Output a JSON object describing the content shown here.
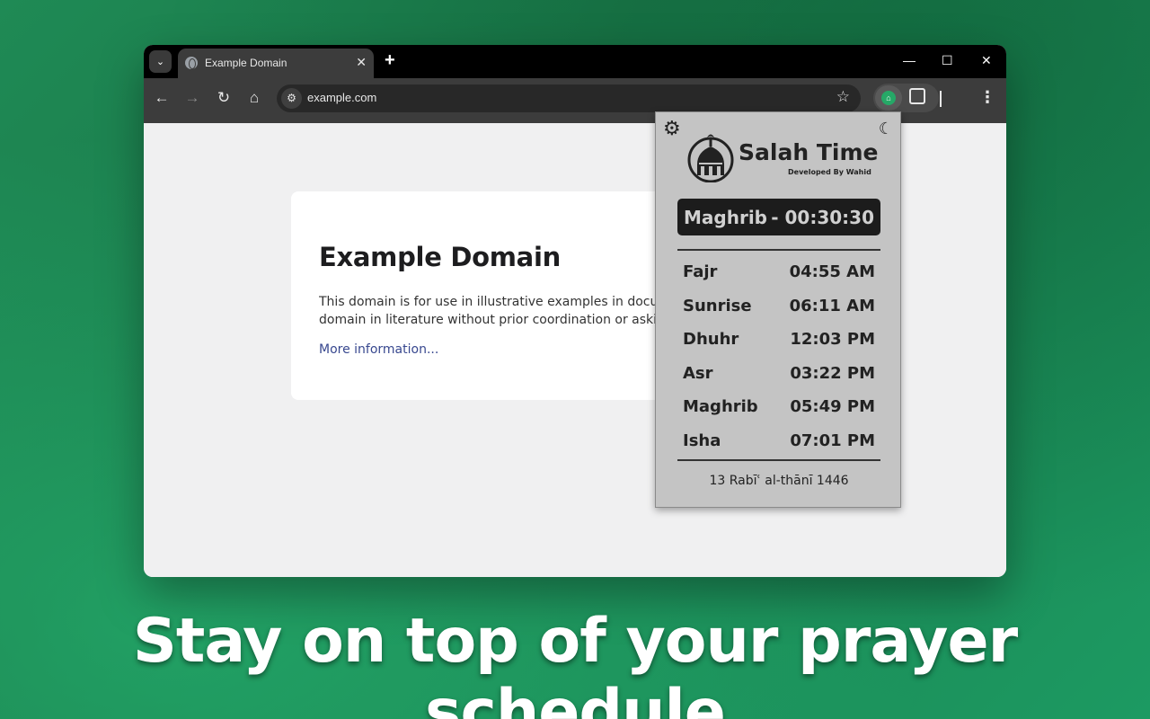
{
  "browser": {
    "tab": {
      "title": "Example Domain"
    },
    "toolbar": {
      "url": "example.com"
    }
  },
  "page": {
    "heading": "Example Domain",
    "paragraph_line1": "This domain is for use in illustrative examples in documents. You may use this",
    "paragraph_line2": "domain in literature without prior coordination or asking for permission.",
    "link": "More information..."
  },
  "extension": {
    "brand": "Salah Time",
    "developer": "Developed By Wahid",
    "next_prayer": {
      "name": "Maghrib",
      "countdown": "- 00:30:30"
    },
    "prayers": [
      {
        "name": "Fajr",
        "time": "04:55 AM"
      },
      {
        "name": "Sunrise",
        "time": "06:11 AM"
      },
      {
        "name": "Dhuhr",
        "time": "12:03 PM"
      },
      {
        "name": "Asr",
        "time": "03:22 PM"
      },
      {
        "name": "Maghrib",
        "time": "05:49 PM"
      },
      {
        "name": "Isha",
        "time": "07:01 PM"
      }
    ],
    "hijri_date": "13 Rabīʿ al-thānī 1446"
  },
  "headline": "Stay on top of your prayer schedule",
  "colors": {
    "accent": "#26a867",
    "popup_bg": "#c4c4c4",
    "next_box_bg": "#1c1c1c"
  }
}
